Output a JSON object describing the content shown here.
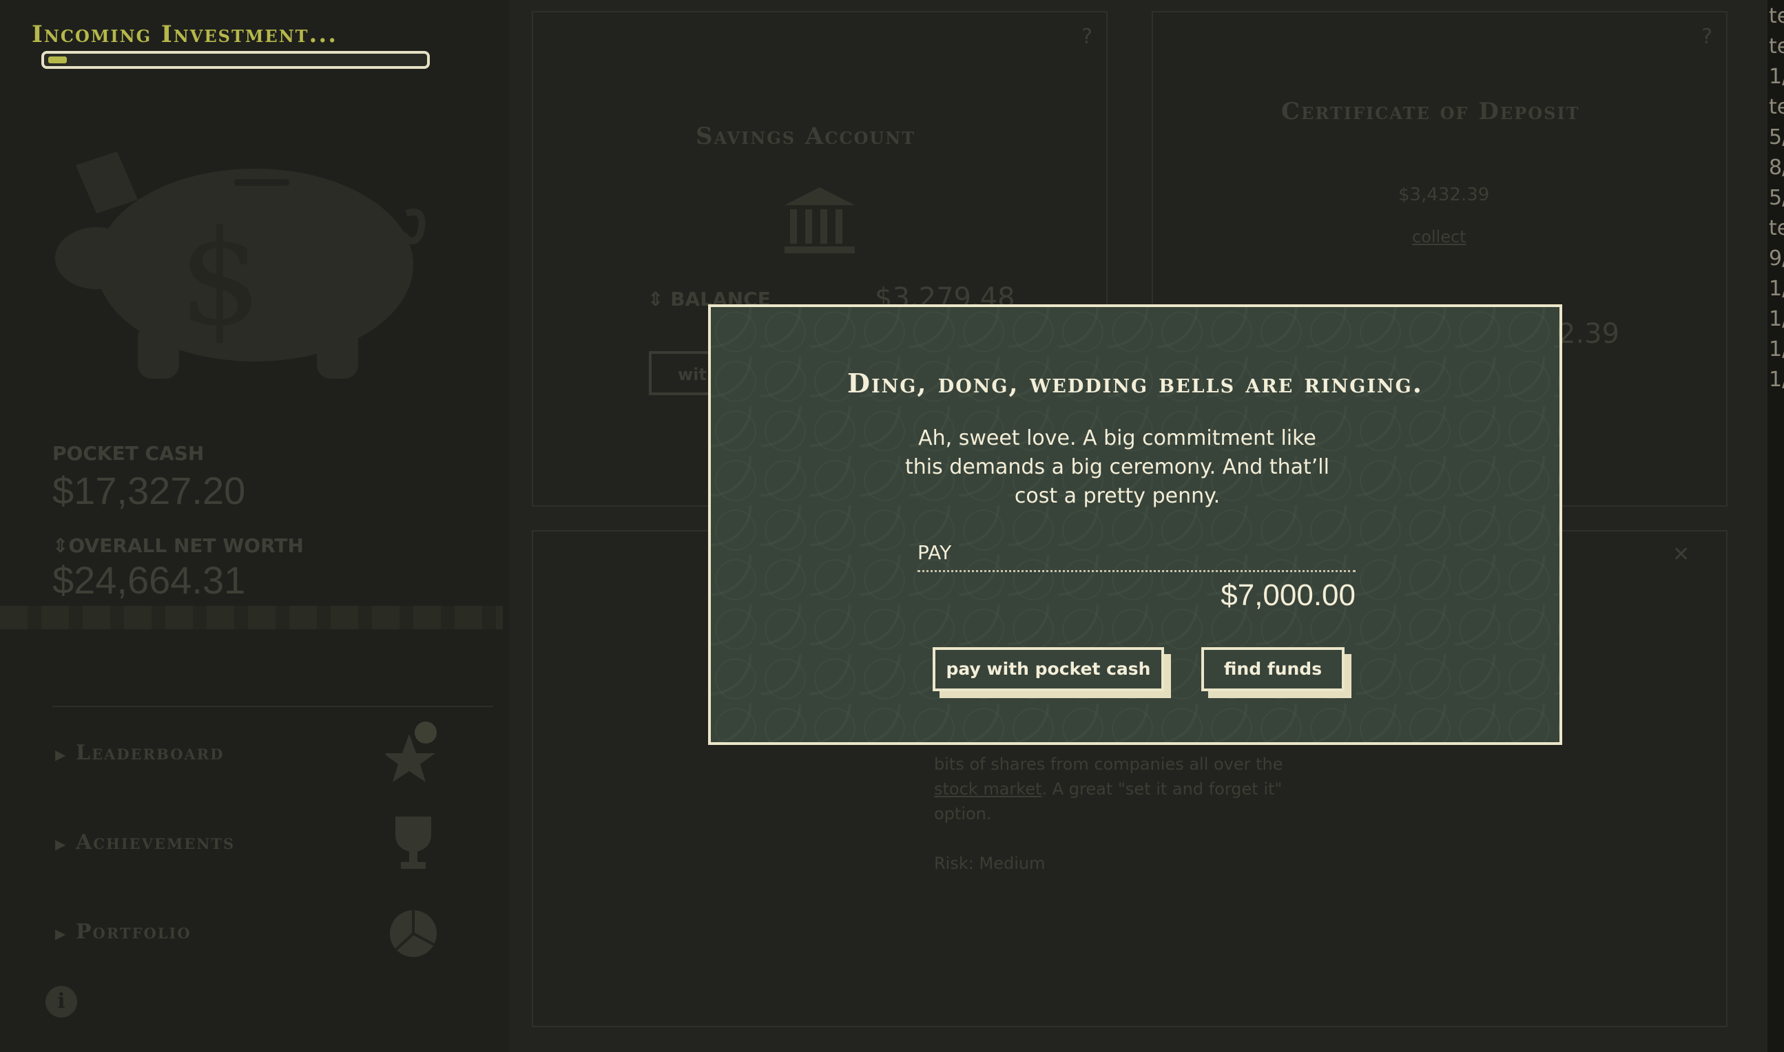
{
  "sidebar": {
    "incoming_title": "Incoming Investment...",
    "progress": 0.05,
    "pocket_cash_label": "POCKET CASH",
    "pocket_cash_value": "$17,327.20",
    "net_worth_label": "OVERALL NET WORTH",
    "net_worth_value": "$24,664.31",
    "nav": [
      {
        "label": "Leaderboard",
        "icon": "star-icon"
      },
      {
        "label": "Achievements",
        "icon": "trophy-icon"
      },
      {
        "label": "Portfolio",
        "icon": "pie-chart-icon"
      }
    ]
  },
  "panels": {
    "savings": {
      "title": "Savings Account",
      "balance_label": "BALANCE",
      "balance_value": "$3,279.48",
      "button_label": "wit"
    },
    "cd": {
      "title": "Certificate of Deposit",
      "amount": "$3,432.39",
      "collect_label": "collect",
      "value": "2.39"
    },
    "bottom": {
      "description_before": "bits of shares from companies all over the ",
      "description_link": "stock market",
      "description_after": ". A great \"set it and forget it\" option.",
      "risk_label": "Risk:",
      "risk_value": "Medium"
    }
  },
  "right_strip": [
    "te",
    "te",
    "1/",
    "te",
    "5/",
    "8/",
    "5/",
    "te",
    "9/",
    "1/",
    "1/",
    "1/",
    "1/"
  ],
  "modal": {
    "title": "Ding, dong, wedding bells are ringing.",
    "body": "Ah, sweet love. A big commitment like this demands a big ceremony. And that’ll cost a pretty penny.",
    "pay_label": "PAY",
    "pay_amount": "$7,000.00",
    "pay_button": "pay with pocket cash",
    "find_button": "find funds"
  },
  "colors": {
    "accent": "#b6b84a",
    "modal_bg": "#38433a",
    "cream": "#ece6c9"
  }
}
